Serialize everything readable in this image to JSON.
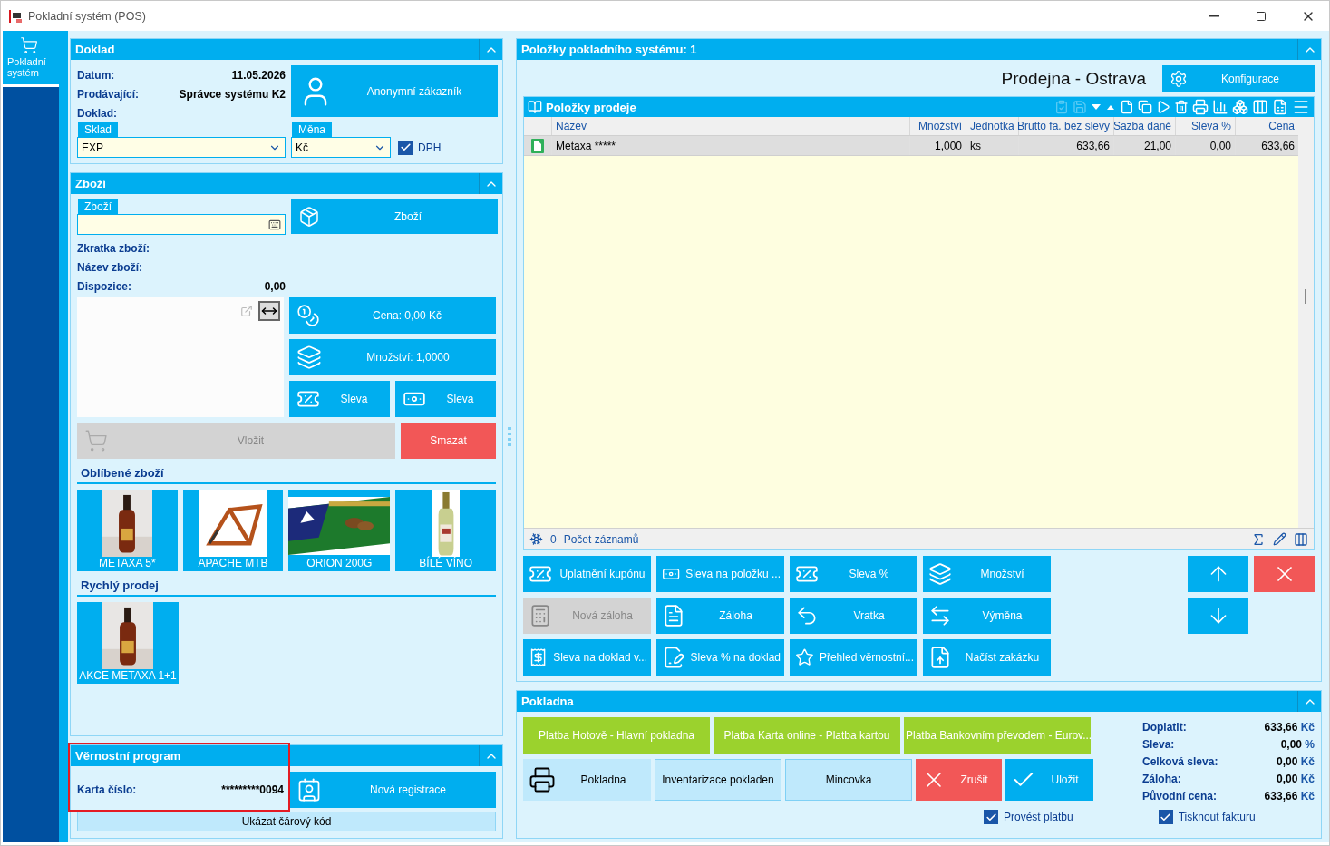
{
  "window": {
    "title": "Pokladní systém (POS)"
  },
  "nav": [
    {
      "label": "Pokladní systém",
      "selected": true
    }
  ],
  "doklad": {
    "title": "Doklad",
    "expanded": true,
    "fields": [
      {
        "label": "Datum:",
        "value": "11.05.2026"
      },
      {
        "label": "Prodávající:",
        "value": "Správce systému K2"
      },
      {
        "label": "Doklad:"
      }
    ],
    "customer_button": "Anonymní zákazník",
    "sklad": {
      "label": "Sklad",
      "value": "EXP"
    },
    "mena": {
      "label": "Měna",
      "value": "Kč"
    },
    "dph": {
      "label": "DPH",
      "checked": true
    }
  },
  "zbozi": {
    "title": "Zboží",
    "expanded": true,
    "field": {
      "label": "Zboží"
    },
    "button": "Zboží",
    "info": [
      {
        "label": "Zkratka zboží:"
      },
      {
        "label": "Název zboží:"
      },
      {
        "label": "Dispozice:",
        "value": "0,00"
      }
    ],
    "price_button": "Cena: 0,00 Kč",
    "quantity_button": "Množství: 1,0000",
    "discount_buttons": [
      {
        "label": "Sleva"
      },
      {
        "label": "Sleva"
      }
    ],
    "insert_button": {
      "label": "Vložit",
      "disabled": true
    },
    "delete_button": "Smazat",
    "favorites": {
      "title": "Oblíbené zboží",
      "items": [
        {
          "label": "METAXA 5*"
        },
        {
          "label": "APACHE MTB"
        },
        {
          "label": "ORION 200G"
        },
        {
          "label": "BÍLÉ VÍNO"
        }
      ]
    },
    "quick_sale": {
      "title": "Rychlý prodej",
      "items": [
        {
          "label": "AKCE METAXA 1+1"
        }
      ]
    }
  },
  "loyalty": {
    "title": "Věrnostní program",
    "expanded": true,
    "highlighted": true,
    "card_label": "Karta číslo:",
    "card_value": "*********0094",
    "register_button": "Nová registrace",
    "barcode_button": "Ukázat čárový kód"
  },
  "items_panel": {
    "title": "Položky pokladního systému: 1",
    "expanded": true,
    "store": "Prodejna - Ostrava",
    "config_button": "Konfigurace",
    "grid": {
      "title": "Položky prodeje",
      "columns": [
        "Název",
        "Množství",
        "Jednotka",
        "Brutto fa. bez slevy",
        "Sazba daně",
        "Sleva %",
        "Cena"
      ],
      "rows": [
        {
          "selected": true,
          "cells": [
            "Metaxa *****",
            "1,000",
            "ks",
            "633,66",
            "21,00",
            "0,00",
            "633,66"
          ]
        }
      ],
      "footer_count": "0",
      "footer_label": "Počet záznamů"
    },
    "actions": [
      {
        "label": "Uplatnění kupónu",
        "disabled": false
      },
      {
        "label": "Sleva na položku ...",
        "disabled": false
      },
      {
        "label": "Sleva %",
        "disabled": false
      },
      {
        "label": "Množství",
        "disabled": false
      },
      {
        "label": "Nová záloha",
        "disabled": true
      },
      {
        "label": "Záloha",
        "disabled": false
      },
      {
        "label": "Vratka",
        "disabled": false
      },
      {
        "label": "Výměna",
        "disabled": false
      },
      {
        "label": "Sleva na doklad v...",
        "disabled": false
      },
      {
        "label": "Sleva % na doklad",
        "disabled": false
      },
      {
        "label": "Přehled věrnostní...",
        "disabled": false
      },
      {
        "label": "Načíst zakázku",
        "disabled": false
      }
    ]
  },
  "pokladna": {
    "title": "Pokladna",
    "expanded": true,
    "payments": [
      "Platba Hotově - Hlavní pokladna",
      "Platba Karta online - Platba kartou",
      "Platba Bankovním převodem - Eurov..."
    ],
    "buttons": [
      {
        "label": "Pokladna",
        "kind": "register"
      },
      {
        "label": "Inventarizace pokladen",
        "kind": "light"
      },
      {
        "label": "Mincovka",
        "kind": "light"
      },
      {
        "label": "Zrušit",
        "kind": "cancel"
      },
      {
        "label": "Uložit",
        "kind": "save"
      }
    ],
    "summary": [
      {
        "label": "Doplatit:",
        "value": "633,66",
        "unit": "Kč"
      },
      {
        "label": "Sleva:",
        "value": "0,00",
        "unit": "%"
      },
      {
        "label": "Celková sleva:",
        "value": "0,00",
        "unit": "Kč"
      },
      {
        "label": "Záloha:",
        "value": "0,00",
        "unit": "Kč"
      },
      {
        "label": "Původní cena:",
        "value": "633,66",
        "unit": "Kč"
      }
    ],
    "checkboxes": [
      {
        "label": "Provést platbu",
        "checked": true
      },
      {
        "label": "Tisknout fakturu",
        "checked": true
      }
    ]
  }
}
